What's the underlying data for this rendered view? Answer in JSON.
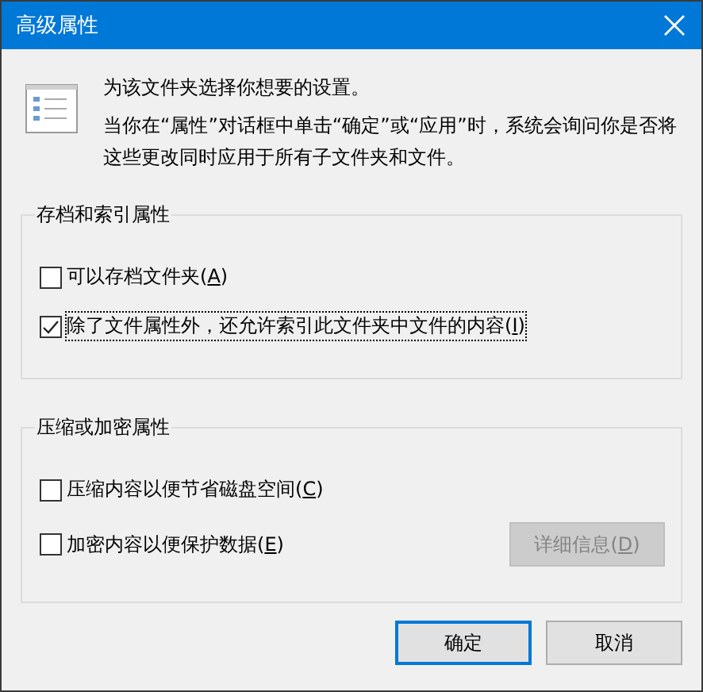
{
  "window": {
    "title": "高级属性"
  },
  "intro": [
    "为该文件夹选择你想要的设置。",
    "当你在“属性”对话框中单击“确定”或“应用”时，系统会询问你是否将这些更改同时应用于所有子文件夹和文件。"
  ],
  "groups": [
    {
      "title": "存档和索引属性",
      "options": [
        {
          "label": "可以存档文件夹",
          "access_key": "(A)",
          "checked": false,
          "focused": false
        },
        {
          "label": "除了文件属性外，还允许索引此文件夹中文件的内容",
          "access_key": "(I)",
          "checked": true,
          "focused": true
        }
      ]
    },
    {
      "title": "压缩或加密属性",
      "options": [
        {
          "label": "压缩内容以便节省磁盘空间",
          "access_key": "(C)",
          "checked": false,
          "focused": false
        },
        {
          "label": "加密内容以便保护数据",
          "access_key": "(E)",
          "checked": false,
          "focused": false
        }
      ],
      "button": {
        "label": "详细信息",
        "access_key": "(D)",
        "disabled": true
      }
    }
  ],
  "buttons": [
    {
      "label": "确定",
      "default": true
    },
    {
      "label": "取消",
      "default": false
    }
  ]
}
